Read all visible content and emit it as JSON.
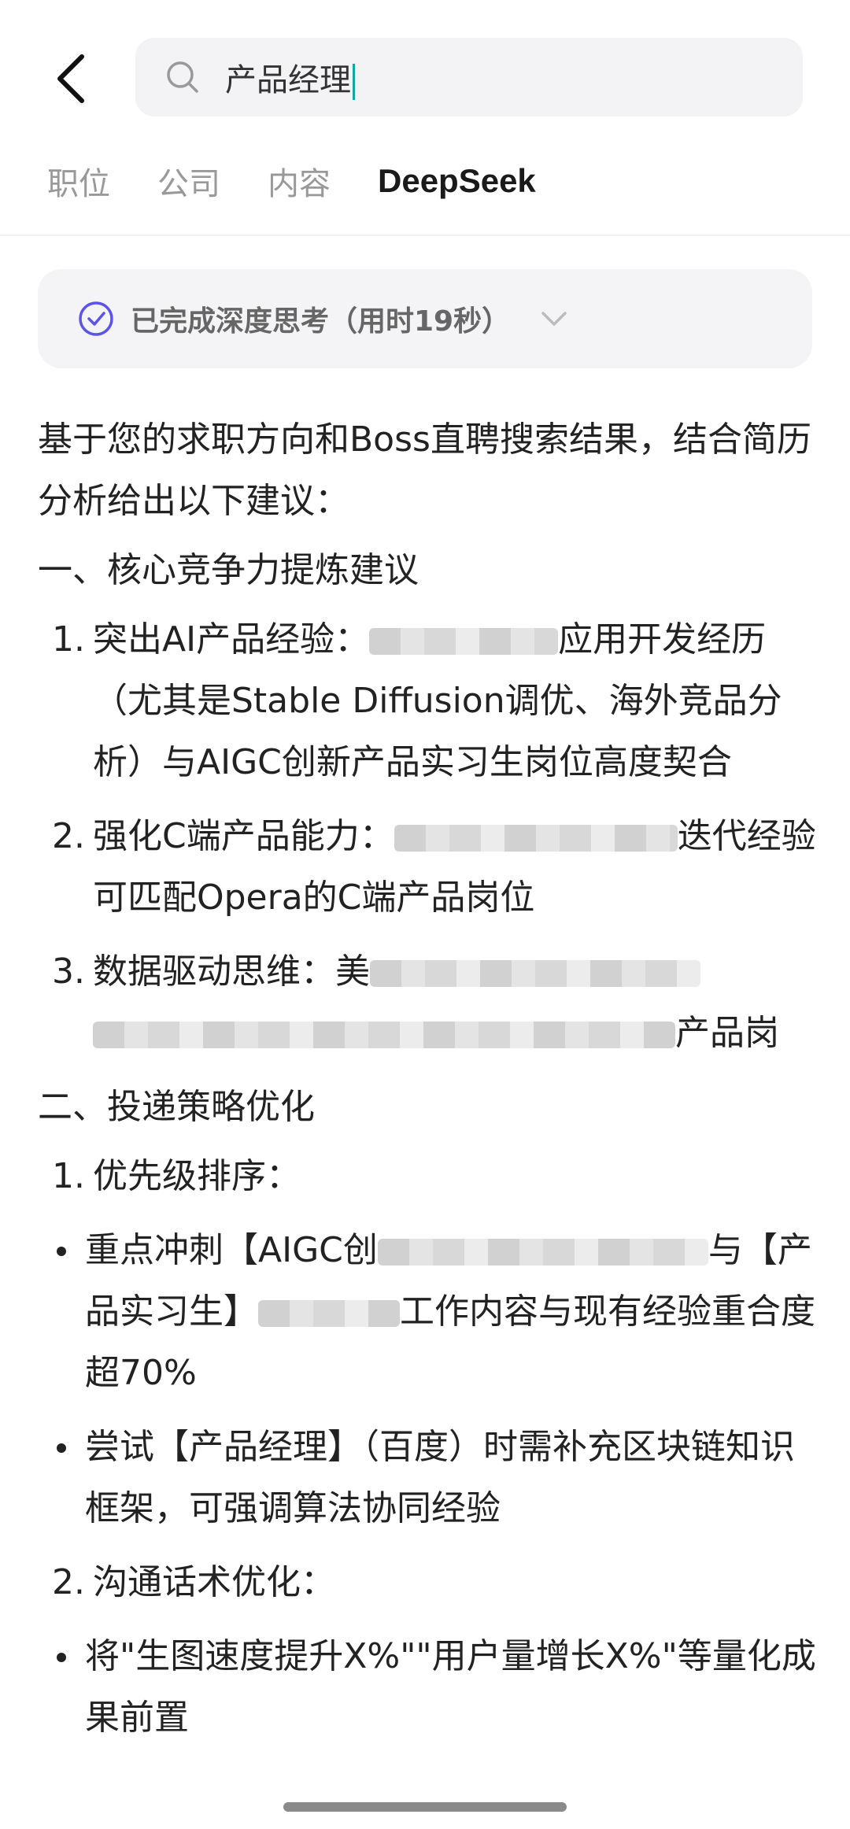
{
  "search": {
    "query": "产品经理"
  },
  "tabs": [
    {
      "label": "职位"
    },
    {
      "label": "公司"
    },
    {
      "label": "内容"
    },
    {
      "label": "DeepSeek"
    }
  ],
  "thinking": {
    "label": "已完成深度思考（用时19秒）"
  },
  "content": {
    "intro": "基于您的求职方向和Boss直聘搜索结果，结合简历分析给出以下建议：",
    "section1": {
      "title": "一、核心竞争力提炼建议",
      "items": [
        {
          "num": "1.",
          "before": "突出AI产品经验：",
          "after": "应用开发经历（尤其是Stable Diffusion调优、海外竞品分析）与AIGC创新产品实习生岗位高度契合"
        },
        {
          "num": "2.",
          "before": "强化C端产品能力：",
          "after": "迭代经验可匹配Opera的C端产品岗位"
        },
        {
          "num": "3.",
          "before": "数据驱动思维：美",
          "after": "产品岗"
        }
      ]
    },
    "section2": {
      "title": "二、投递策略优化",
      "sub1": {
        "num": "1.",
        "label": "优先级排序："
      },
      "bullets": [
        {
          "before": "重点冲刺【AIGC创",
          "middle": "与【产品实习生】",
          "after": "工作内容与现有经验重合度超70%"
        },
        {
          "text": "尝试【产品经理】（百度）时需补充区块链知识框架，可强调算法协同经验"
        }
      ],
      "sub2": {
        "num": "2.",
        "label": "沟通话术优化："
      },
      "last_bullet": "将\"生图速度提升X%\"\"用户量增长X%\"等量化成果前置"
    }
  },
  "colors": {
    "accent": "#5b54e8",
    "caret": "#16a6a0"
  }
}
